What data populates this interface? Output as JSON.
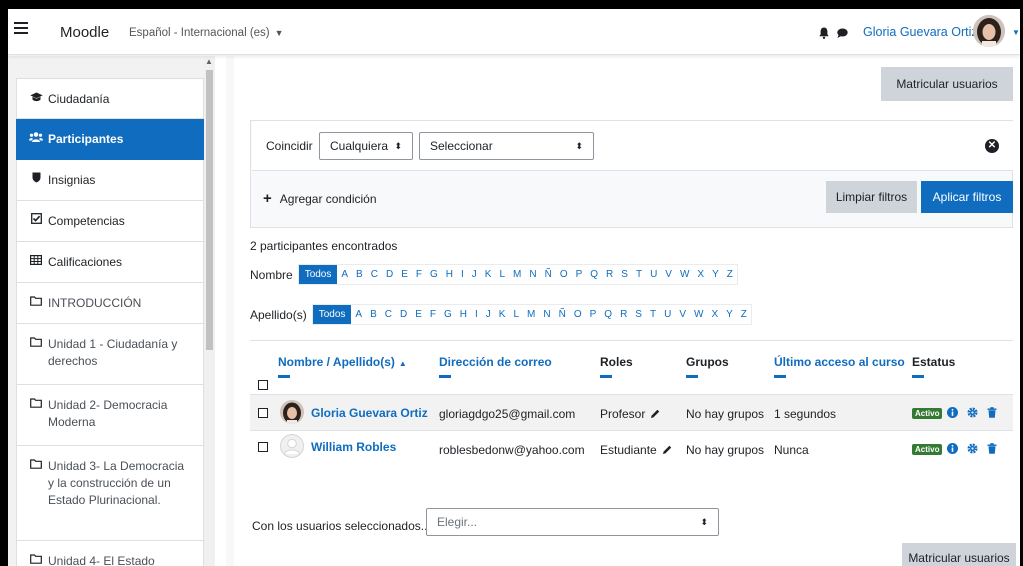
{
  "navbar": {
    "site_name": "Moodle",
    "language": "Español - Internacional (es)",
    "user_name": "Gloria Guevara Ortiz"
  },
  "drawer": {
    "items": [
      {
        "icon": "graduation-cap-icon",
        "label": "Ciudadanía",
        "active": false
      },
      {
        "icon": "users-icon",
        "label": "Participantes",
        "active": true
      },
      {
        "icon": "shield-icon",
        "label": "Insignias",
        "active": false
      },
      {
        "icon": "check-square-icon",
        "label": "Competencias",
        "active": false
      },
      {
        "icon": "table-icon",
        "label": "Calificaciones",
        "active": false
      },
      {
        "icon": "folder-icon",
        "label": "INTRODUCCIÓN",
        "active": false
      },
      {
        "icon": "folder-icon",
        "label": "Unidad 1 - Ciudadanía y derechos",
        "active": false
      },
      {
        "icon": "folder-icon",
        "label": "Unidad 2- Democracia Moderna",
        "active": false
      },
      {
        "icon": "folder-icon",
        "label": "Unidad 3- La Democracia y la construcción de un Estado Plurinacional.",
        "active": false
      },
      {
        "icon": "folder-icon",
        "label": "Unidad 4- El Estado",
        "active": false
      }
    ]
  },
  "main": {
    "enrol_button": "Matricular usuarios",
    "filter": {
      "match_label": "Coincidir",
      "match_value": "Cualquiera",
      "type_value": "Seleccionar",
      "add_condition": "Agregar condición",
      "clear_filters": "Limpiar filtros",
      "apply_filters": "Aplicar filtros"
    },
    "participants_count": "2 participantes encontrados",
    "initials": {
      "first_label": "Nombre",
      "last_label": "Apellido(s)",
      "all_label": "Todos",
      "letters": [
        "A",
        "B",
        "C",
        "D",
        "E",
        "F",
        "G",
        "H",
        "I",
        "J",
        "K",
        "L",
        "M",
        "N",
        "Ñ",
        "O",
        "P",
        "Q",
        "R",
        "S",
        "T",
        "U",
        "V",
        "W",
        "X",
        "Y",
        "Z"
      ]
    },
    "table": {
      "headers": {
        "name": "Nombre / Apellido(s)",
        "email": "Dirección de correo",
        "roles": "Roles",
        "groups": "Grupos",
        "last_access": "Último acceso al curso",
        "status": "Estatus"
      },
      "rows": [
        {
          "name": "Gloria Guevara Ortiz",
          "email": "gloriagdgo25@gmail.com",
          "role": "Profesor",
          "groups": "No hay grupos",
          "last_access": "1 segundos",
          "status": "Activo"
        },
        {
          "name": "William Robles",
          "email": "roblesbedonw@yahoo.com",
          "role": "Estudiante",
          "groups": "No hay grupos",
          "last_access": "Nunca",
          "status": "Activo"
        }
      ]
    },
    "bulk": {
      "label": "Con los usuarios seleccionados...",
      "select_value": "Elegir..."
    }
  },
  "colors": {
    "primary": "#0f6cbf",
    "active_badge": "#357a32",
    "secondary_button": "#ced4da"
  }
}
